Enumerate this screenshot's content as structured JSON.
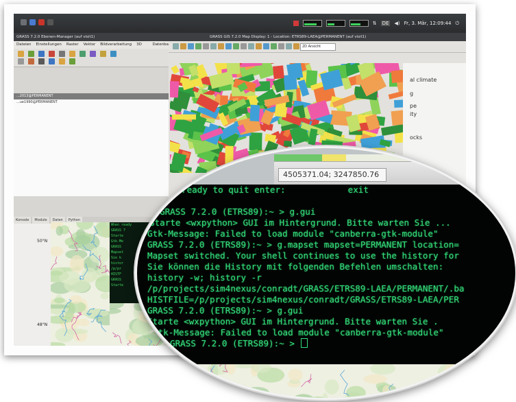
{
  "system_panel": {
    "clock": "Fr, 3. Mär, 12:09:44",
    "lang": "DE"
  },
  "layer_manager": {
    "title": "GRASS 7.2.0 Ebenen-Manager (auf visit1)",
    "menu": [
      "Dateien",
      "Einstellungen",
      "Raster",
      "Vektor",
      "Bildverarbeitung",
      "3D raster",
      "Datenbank",
      "Temporal"
    ],
    "layers": [
      "...2013@PERMANENT",
      "...ue1990@PERMANENT"
    ],
    "tabs": [
      "Konsole",
      "Module",
      "Daten",
      "Python"
    ]
  },
  "map_display": {
    "title": "GRASS GIS 7.2.0 Map Display: 1 - Location: ETRS89-LAEA@PERMANENT (auf visit1)",
    "view_select": "2D Ansicht",
    "legend": [
      "al climate",
      "g",
      "pe",
      "ity",
      "ocks"
    ]
  },
  "lower_console": {
    "lines": [
      "When ready",
      "GRASS 7",
      "Starte",
      "Gtk-Me",
      "GRASS",
      "Mapset",
      "Sie k",
      "histor",
      "/p/pr",
      "HISTF",
      "GRASS",
      "Starte"
    ]
  },
  "mini_map": {
    "lat_labels": [
      "50°N",
      "48°N"
    ]
  },
  "callout": {
    "coordinates": "4505371.04; 3247850.76",
    "terminal_lines": [
      "ready to quit enter:            exit",
      "",
      "GRASS 7.2.0 (ETRS89):~ > g.gui",
      "Starte <wxpython> GUI im Hintergrund. Bitte warten Sie ...",
      "Gtk-Message: Failed to load module \"canberra-gtk-module\"",
      "GRASS 7.2.0 (ETRS89):~ > g.mapset mapset=PERMANENT location=",
      "Mapset switched. Your shell continues to use the history for",
      "Sie können die History mit folgenden Befehlen umschalten:",
      "history -w; history -r",
      "/p/projects/sim4nexus/conradt/GRASS/ETRS89-LAEA/PERMANENT/.ba",
      "HISTFILE=/p/projects/sim4nexus/conradt/GRASS/ETRS89-LAEA/PER",
      "GRASS 7.2.0 (ETRS89):~ > g.gui",
      "Starte <wxpython> GUI im Hintergrund. Bitte warten Sie .",
      "Gtk-Message: Failed to load module \"canberra-gtk-module\"",
      "GRASS 7.2.0 (ETRS89):~ > "
    ]
  },
  "colors": {
    "terminal_text": "#33e07a",
    "terminal_bg": "#020403",
    "card": "#fdfdfd"
  }
}
